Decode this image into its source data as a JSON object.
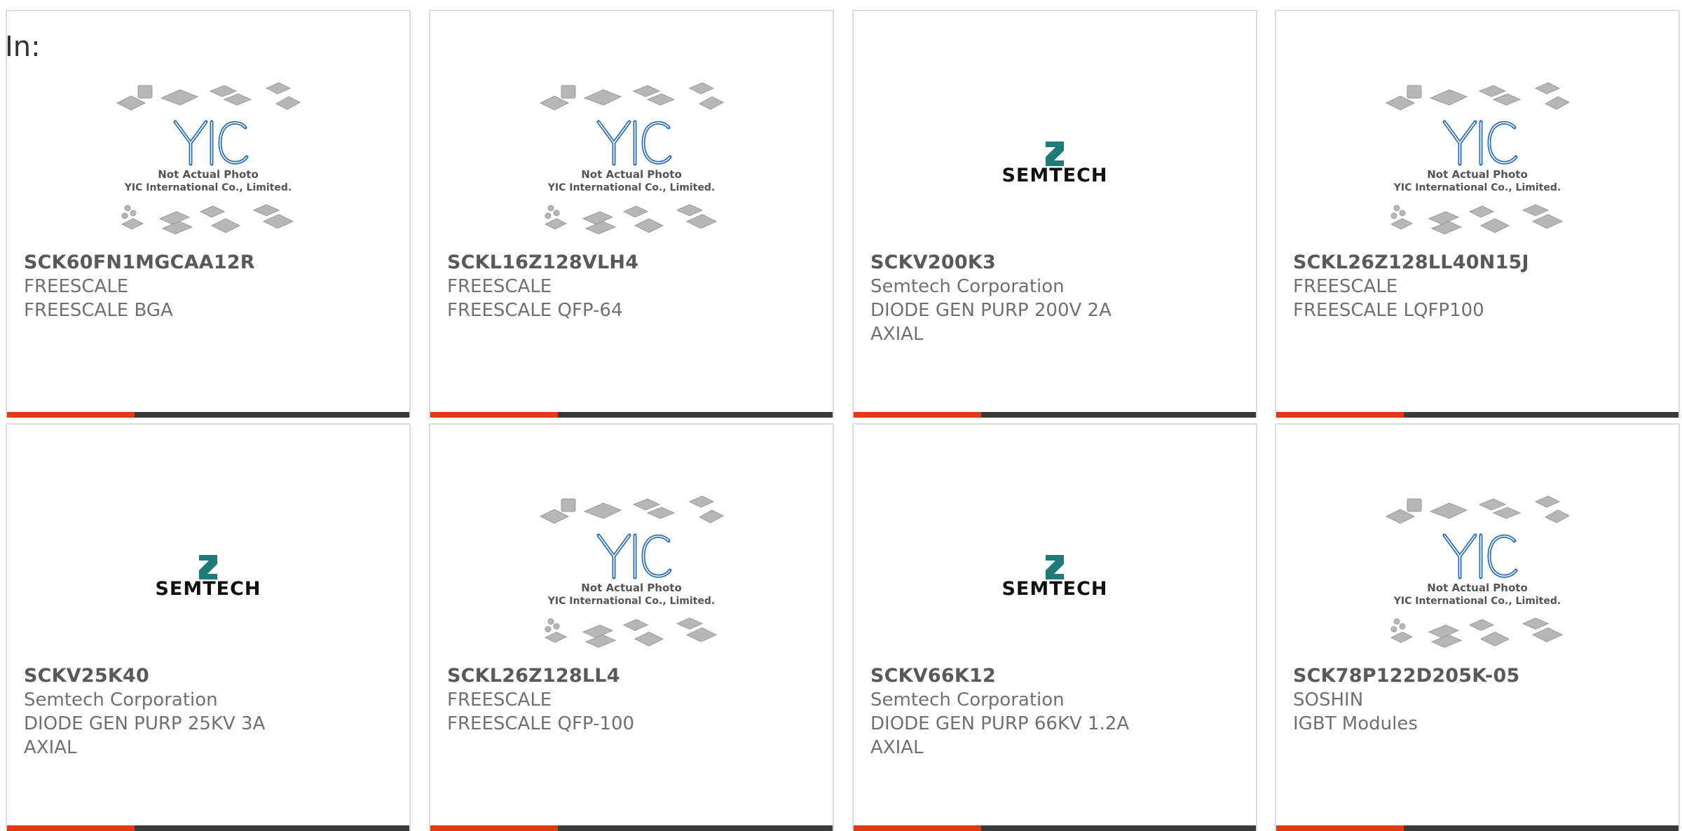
{
  "header": {
    "in_label": "In:"
  },
  "placeholder_text": {
    "line1": "Not Actual Photo",
    "line2": "YIC International Co., Limited."
  },
  "semtech_logo_text": "SEMTECH",
  "colors": {
    "accent": "#e03a10",
    "bar": "#3b3b3b",
    "brand_teal": "#1f7a78",
    "yic_blue": "#2a6fb7"
  },
  "products": [
    {
      "part": "SCK60FN1MGCAA12R",
      "maker": "FREESCALE",
      "desc": "FREESCALE BGA",
      "image": "yic-placeholder"
    },
    {
      "part": "SCKL16Z128VLH4",
      "maker": "FREESCALE",
      "desc": "FREESCALE QFP-64",
      "image": "yic-placeholder"
    },
    {
      "part": "SCKV200K3",
      "maker": "Semtech Corporation",
      "desc": "DIODE GEN PURP 200V 2A AXIAL",
      "image": "semtech-logo"
    },
    {
      "part": "SCKL26Z128LL40N15J",
      "maker": "FREESCALE",
      "desc": "FREESCALE LQFP100",
      "image": "yic-placeholder"
    },
    {
      "part": "SCKV25K40",
      "maker": "Semtech Corporation",
      "desc": "DIODE GEN PURP 25KV 3A AXIAL",
      "image": "semtech-logo"
    },
    {
      "part": "SCKL26Z128LL4",
      "maker": "FREESCALE",
      "desc": "FREESCALE QFP-100",
      "image": "yic-placeholder"
    },
    {
      "part": "SCKV66K12",
      "maker": "Semtech Corporation",
      "desc": "DIODE GEN PURP 66KV 1.2A AXIAL",
      "image": "semtech-logo"
    },
    {
      "part": "SCK78P122D205K-05",
      "maker": "SOSHIN",
      "desc": "IGBT Modules",
      "image": "yic-placeholder"
    }
  ]
}
